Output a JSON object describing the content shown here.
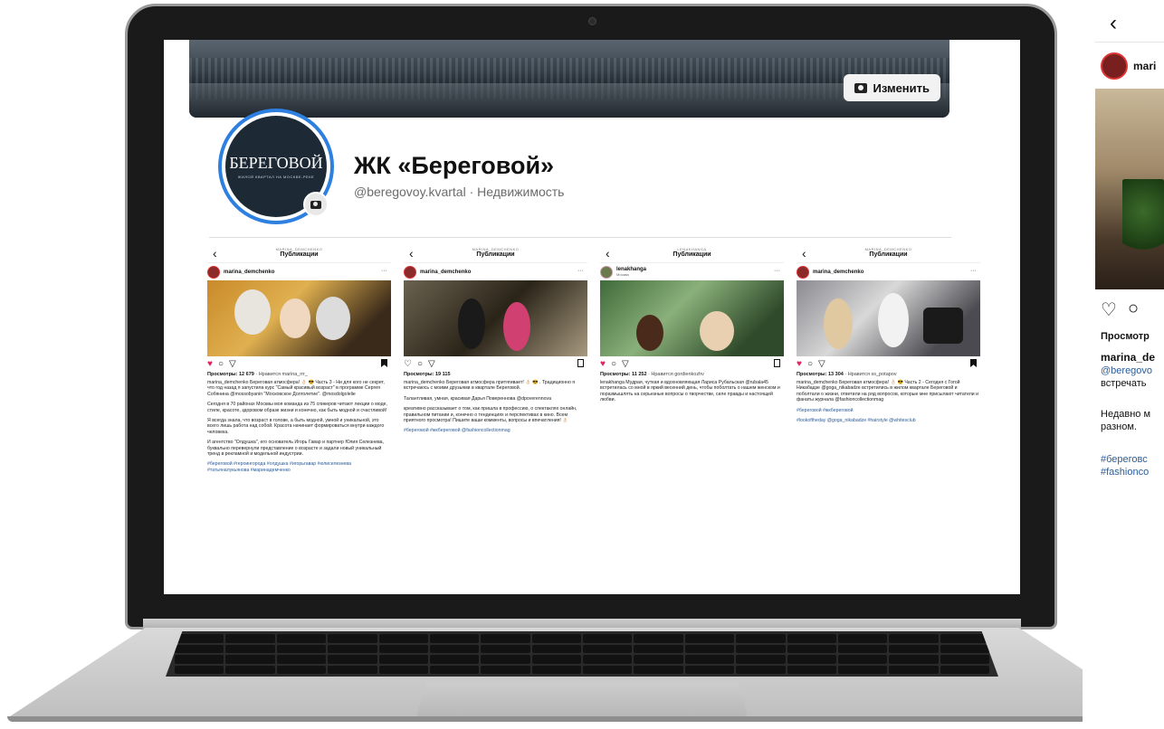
{
  "profile": {
    "edit_label": "Изменить",
    "logo_text": "БЕРЕГОВОЙ",
    "logo_sub": "ЖИЛОЙ КВАРТАЛ НА МОСКВЕ-РЕКЕ",
    "title": "ЖК «Береговой»",
    "subtitle": "@beregovoy.kvartal · Недвижимость"
  },
  "posts": [
    {
      "owner": "MARINA_DEMCHENKO",
      "header": "Публикации",
      "username": "marina_demchenko",
      "location": "",
      "views": "Просмотры: 12 679",
      "liked_by": "· Нравится marina_rrr_",
      "caption": "marina_demchenko Береговая атмосфера! 👌🏻 😎 Часть 3 - Ни для кого не секрет, что год назад я запустила курс \"Самый красивый возраст\" в программе Сергея Собянина @mossobyanin \"Московское Долголетие\". @mosdolgolelie",
      "p2": "Сегодня в 70 районах Москвы моя команда из 75 спикеров читают лекции о моде, стиле, красоте, здоровом образе жизни и конечно, как быть модной и счастливой!",
      "p3": "Я всегда знала, что возраст в голове, а быть модной, умной и уникальной, это всего лишь работа над собой. Красота начинает формироваться внутри каждого человека.",
      "p4": "И агентство \"Олдушка\", его основатель Игорь Гавар и партнер Юлия Селезнева, буквально перевернули представление о возрасте и задали новый уникальный тренд в рекламной и модельной индустрии.",
      "tags": "#береговой #героингорода #олдушка #игорьгавар #юлиселезнева #татьяналукьянова #маринадемченко"
    },
    {
      "owner": "MARINA_DEMCHENKO",
      "header": "Публикации",
      "username": "marina_demchenko",
      "location": "",
      "views": "Просмотры: 19 115",
      "liked_by": "",
      "caption": "marina_demchenko Береговая атмосфера притягивает! 👌🏻 😎 . Традиционно я встречаюсь с моими друзьями в квартале Береговой.",
      "p2": "Талантливая, умная, красивая Дарья Повереннова @dpoverennova",
      "p3": "креативно рассказывает о том, как пришла в профессию, о спектаклях онлайн, правильном питании и, конечно о тенденциях и перспективах в кино. Всем приятного просмотра! Пишите ваши комменты, вопросы и впечатления! 👌🏻",
      "p4": "",
      "tags": "#береговой #жкбереговой @fashioncollectionmag"
    },
    {
      "owner": "LENAKHANGA",
      "header": "Публикации",
      "username": "lenakhanga",
      "location": "Москва",
      "views": "Просмотры: 11 252",
      "liked_by": "· Нравится gordienkozhv",
      "caption": "lenakhanga Мудрая, чуткая и вдохновляющая Лариса Рубальская @rubala45 встретилась со мной в яркий весенний день, чтобы поболтать о нашем женском и поразмышлять на серьезные вопросы о творчестве, силе правды и настоящей любви.",
      "p2": "",
      "p3": "",
      "p4": "",
      "tags": ""
    },
    {
      "owner": "MARINA_DEMCHENKO",
      "header": "Публикации",
      "username": "marina_demchenko",
      "location": "",
      "views": "Просмотры: 13 304",
      "liked_by": "· Нравится ss_potapov",
      "caption": "marina_demchenko Береговая атмосфера! 👌🏻 😎 Часть 2 - Сегодня с Гогой Никабадзе @goga_nikabadze встретились в жилом квартале Береговой и поболтали о жизни, ответили на ряд вопросов, которые мне присылают читатели и фанаты журнала @fashioncollectionmag",
      "p2": "#береговой #жкбереговой",
      "p3": "#lookoftheday @goga_nikabadze #hairstyle @whitesclub",
      "p4": "",
      "tags": ""
    }
  ],
  "phone": {
    "back": "‹",
    "username": "mari",
    "views": "Просмотр",
    "caption_user": "marina_de",
    "mention": "@beregovo",
    "text1": "встречать",
    "text2": "Недавно м",
    "text3": "разном.",
    "tag1": "#береговс",
    "tag2": "#fashionco"
  },
  "colors": {
    "accent_blue": "#2d7fe0",
    "like_red": "#e0245e",
    "link": "#2b5c9a"
  }
}
